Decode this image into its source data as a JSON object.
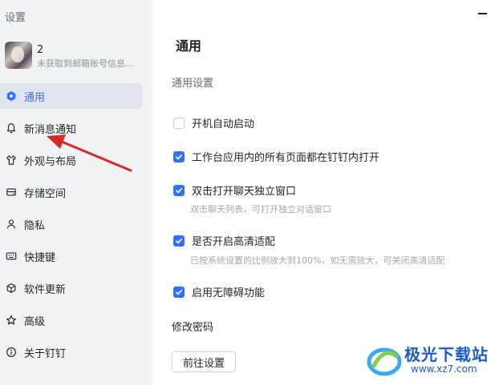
{
  "window": {
    "title": "设置"
  },
  "profile": {
    "name": "2",
    "email": "未获取到邮箱账号信息..."
  },
  "sidebar": {
    "items": [
      {
        "label": "通用",
        "icon": "hexagon-icon",
        "active": true
      },
      {
        "label": "新消息通知",
        "icon": "bell-icon"
      },
      {
        "label": "外观与布局",
        "icon": "shirt-icon"
      },
      {
        "label": "存储空间",
        "icon": "storage-icon"
      },
      {
        "label": "隐私",
        "icon": "person-icon"
      },
      {
        "label": "快捷键",
        "icon": "keyboard-icon"
      },
      {
        "label": "软件更新",
        "icon": "cube-icon"
      },
      {
        "label": "高级",
        "icon": "star-icon"
      },
      {
        "label": "关于钉钉",
        "icon": "info-icon"
      }
    ]
  },
  "main": {
    "title": "通用",
    "section": "通用设置",
    "options": [
      {
        "label": "开机自动启动",
        "checked": false,
        "hint": ""
      },
      {
        "label": "工作台应用内的所有页面都在钉钉内打开",
        "checked": true,
        "hint": ""
      },
      {
        "label": "双击打开聊天独立窗口",
        "checked": true,
        "hint": "双击聊天列表，可打开独立对话窗口"
      },
      {
        "label": "是否开启高清适配",
        "checked": true,
        "hint": "已按系统设置的比例放大到100%，如无需放大，可关闭高清适配"
      },
      {
        "label": "启用无障碍功能",
        "checked": true,
        "hint": ""
      }
    ],
    "password_title": "修改密码",
    "password_button": "前往设置"
  },
  "watermark": {
    "name": "极光下载站",
    "url": "www.xz7.com"
  },
  "colors": {
    "accent": "#3370ff",
    "sidebar_bg": "#f2f3f5",
    "active_bg": "#e1e6ee",
    "arrow": "#d42a2a"
  }
}
